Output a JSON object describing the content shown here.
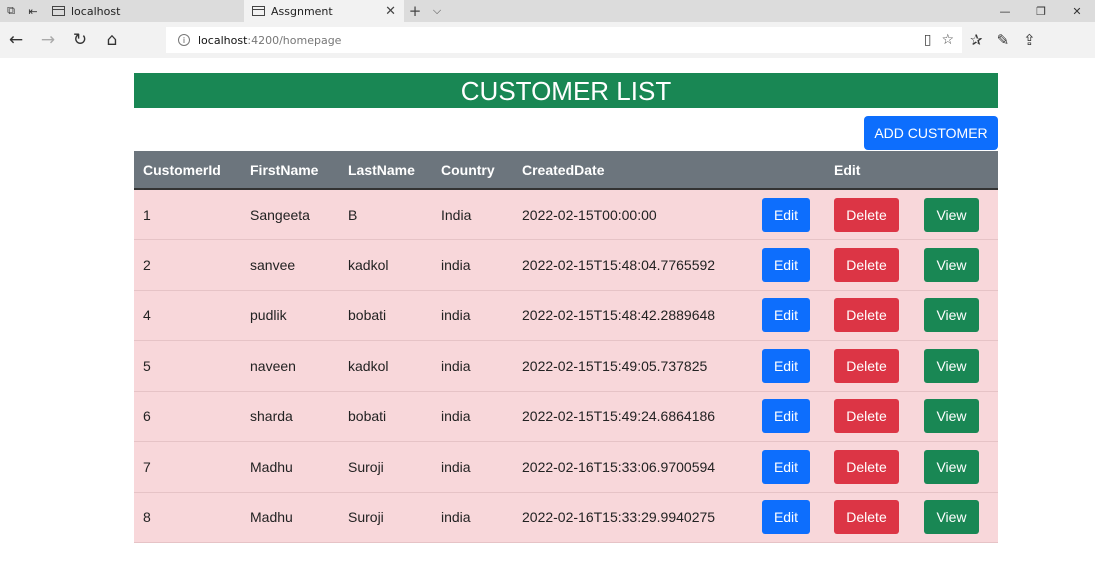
{
  "browser": {
    "tabs": [
      {
        "label": "localhost"
      },
      {
        "label": "Assgnment"
      }
    ],
    "url_host": "localhost",
    "url_path": ":4200/homepage"
  },
  "page": {
    "title": "CUSTOMER LIST",
    "add_button": "ADD CUSTOMER"
  },
  "table": {
    "headers": [
      "CustomerId",
      "FirstName",
      "LastName",
      "Country",
      "CreatedDate",
      "",
      "Edit",
      ""
    ],
    "rows": [
      {
        "id": "1",
        "first": "Sangeeta",
        "last": "B",
        "country": "India",
        "created": "2022-02-15T00:00:00"
      },
      {
        "id": "2",
        "first": "sanvee",
        "last": "kadkol",
        "country": "india",
        "created": "2022-02-15T15:48:04.7765592"
      },
      {
        "id": "4",
        "first": "pudlik",
        "last": "bobati",
        "country": "india",
        "created": "2022-02-15T15:48:42.2889648"
      },
      {
        "id": "5",
        "first": "naveen",
        "last": "kadkol",
        "country": "india",
        "created": "2022-02-15T15:49:05.737825"
      },
      {
        "id": "6",
        "first": "sharda",
        "last": "bobati",
        "country": "india",
        "created": "2022-02-15T15:49:24.6864186"
      },
      {
        "id": "7",
        "first": "Madhu",
        "last": "Suroji",
        "country": "india",
        "created": "2022-02-16T15:33:06.9700594"
      },
      {
        "id": "8",
        "first": "Madhu",
        "last": "Suroji",
        "country": "india",
        "created": "2022-02-16T15:33:29.9940275"
      }
    ],
    "edit_label": "Edit",
    "delete_label": "Delete",
    "view_label": "View"
  },
  "colors": {
    "title_bg": "#198754",
    "primary": "#0d6efd",
    "danger": "#dc3545",
    "success": "#198754",
    "row_bg": "#f8d7da",
    "header_bg": "#6c757d"
  }
}
